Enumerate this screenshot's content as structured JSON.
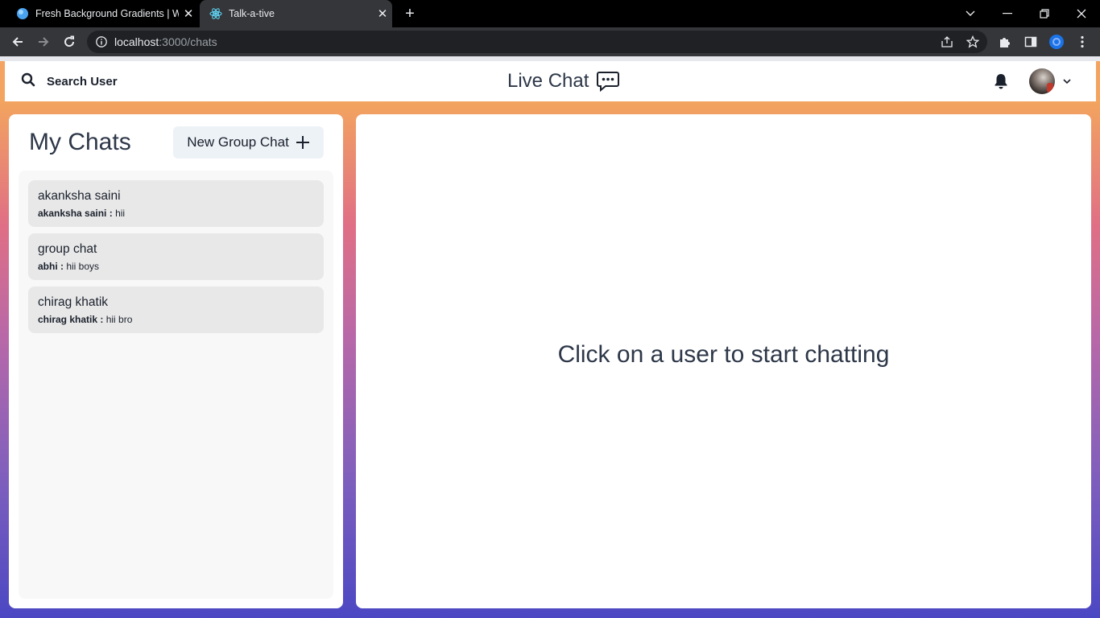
{
  "browser": {
    "tabs": [
      {
        "title": "Fresh Background Gradients | We",
        "icon": "gradient-favicon-icon"
      },
      {
        "title": "Talk-a-tive",
        "icon": "react-favicon-icon"
      }
    ],
    "address": {
      "host": "localhost",
      "path": ":3000/chats"
    }
  },
  "header": {
    "search_label": "Search User",
    "app_title": "Live Chat"
  },
  "chats_panel": {
    "title": "My Chats",
    "new_group_label": "New Group Chat",
    "chats": [
      {
        "name": "akanksha saini",
        "sender": "akanksha saini :",
        "message": "hii"
      },
      {
        "name": "group chat",
        "sender": "abhi :",
        "message": "hii boys"
      },
      {
        "name": "chirag khatik",
        "sender": "chirag khatik :",
        "message": "hii bro"
      }
    ]
  },
  "chat_area": {
    "placeholder": "Click on a user to start chatting"
  },
  "colors": {
    "gradient_top": "#f4a461",
    "gradient_mid": "#b868a8",
    "gradient_bottom": "#4b47c3",
    "chat_item_bg": "#e8e8e8"
  }
}
